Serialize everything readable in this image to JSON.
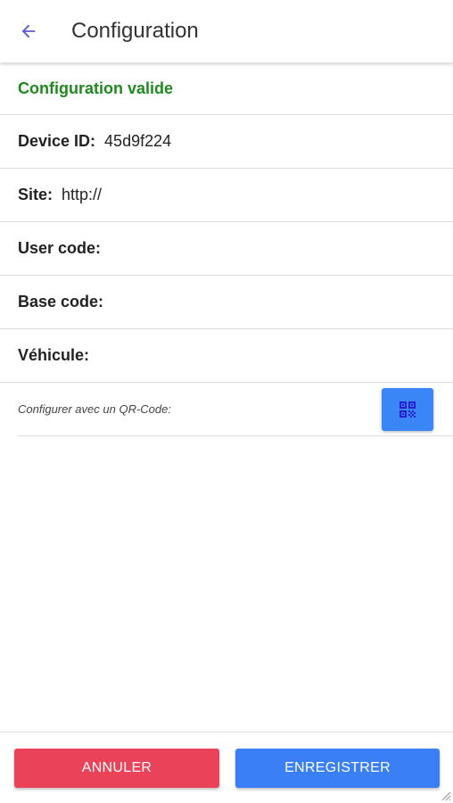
{
  "header": {
    "title": "Configuration",
    "back_icon": "arrow-left-icon",
    "accent": "#5b57d6"
  },
  "status": {
    "text": "Configuration valide",
    "color": "#1e8a1e"
  },
  "fields": [
    {
      "label": "Device ID:",
      "value": "45d9f224"
    },
    {
      "label": "Site:",
      "value": "http://"
    },
    {
      "label": "User code:",
      "value": ""
    },
    {
      "label": "Base code:",
      "value": ""
    },
    {
      "label": "Véhicule:",
      "value": ""
    }
  ],
  "qr": {
    "label": "Configurer avec un QR-Code:",
    "icon": "qr-code-icon",
    "button_color": "#3a86f7"
  },
  "footer": {
    "cancel_label": "ANNULER",
    "cancel_color": "#ea4359",
    "save_label": "ENREGISTRER",
    "save_color": "#3a7ff6"
  }
}
